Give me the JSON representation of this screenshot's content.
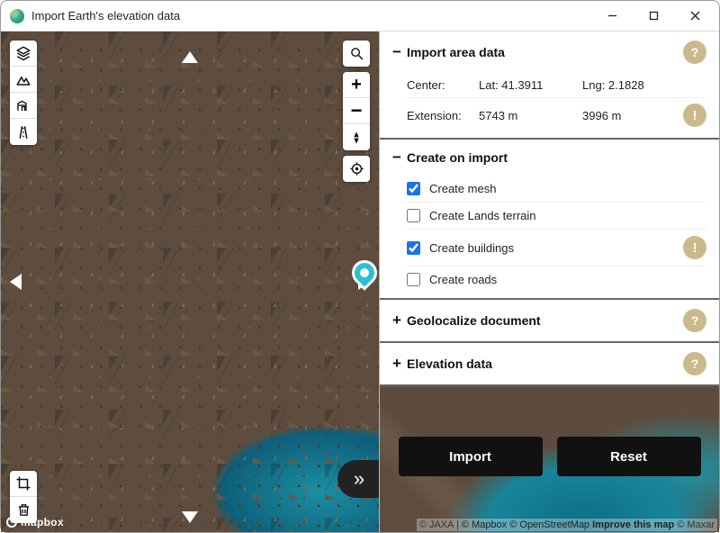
{
  "window": {
    "title": "Import Earth's elevation data"
  },
  "import_area": {
    "title": "Import area data",
    "center_label": "Center:",
    "lat_label": "Lat: 41.3911",
    "lng_label": "Lng: 2.1828",
    "extension_label": "Extension:",
    "ext_w": "5743 m",
    "ext_h": "3996 m"
  },
  "create_on_import": {
    "title": "Create on import",
    "items": [
      {
        "label": "Create mesh",
        "checked": true
      },
      {
        "label": "Create Lands terrain",
        "checked": false
      },
      {
        "label": "Create buildings",
        "checked": true,
        "warn": true
      },
      {
        "label": "Create roads",
        "checked": false
      }
    ]
  },
  "geolocalize": {
    "title": "Geolocalize document"
  },
  "elevation": {
    "title": "Elevation data"
  },
  "actions": {
    "import": "Import",
    "reset": "Reset"
  },
  "attribution": {
    "jaxa": "© JAXA",
    "mapbox": "© Mapbox",
    "osm": "© OpenStreetMap",
    "improve": "Improve this map",
    "maxar": "© Maxar",
    "logo": "mapbox"
  },
  "icons": {
    "help": "?",
    "warn": "!",
    "minus": "−",
    "plus": "+",
    "chevrons": "»"
  }
}
